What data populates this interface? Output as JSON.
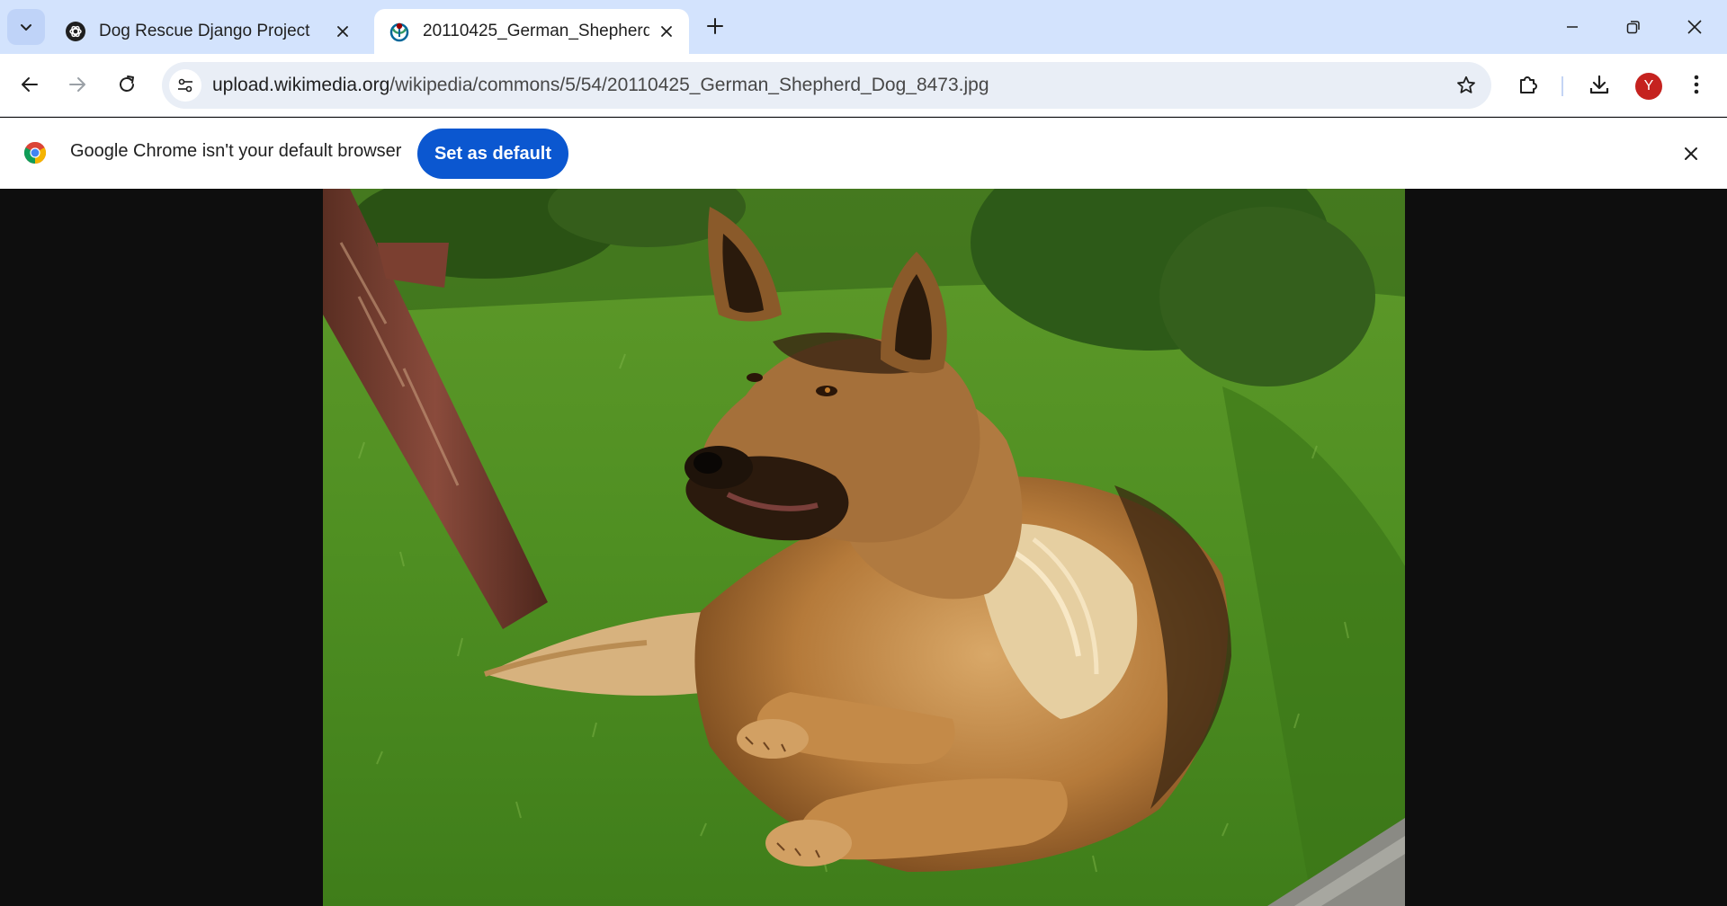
{
  "browser": {
    "tabs": [
      {
        "title": "Dog Rescue Django Project",
        "favicon": "chatgpt-icon",
        "active": false
      },
      {
        "title": "20110425_German_Shepherd_D",
        "favicon": "wikimedia-icon",
        "active": true
      }
    ],
    "address": {
      "host": "upload.wikimedia.org",
      "path": "/wikipedia/commons/5/54/20110425_German_Shepherd_Dog_8473.jpg"
    },
    "profile_initial": "Y",
    "accent_color": "#0b57d0",
    "profile_color": "#c5221f"
  },
  "infobar": {
    "message": "Google Chrome isn't your default browser",
    "button_label": "Set as default"
  },
  "viewer": {
    "image_subject": "German Shepherd dog lying on grass"
  }
}
